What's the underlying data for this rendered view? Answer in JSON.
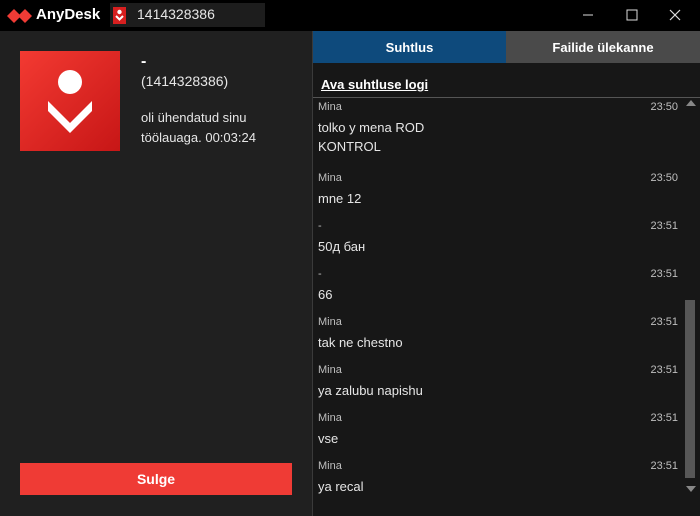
{
  "titlebar": {
    "app_name": "AnyDesk",
    "address": "1414328386",
    "icons": {
      "logo": "anydesk-logo-icon",
      "address": "anydesk-id-icon",
      "minimize": "minimize-icon",
      "maximize": "maximize-icon",
      "close": "close-icon"
    }
  },
  "session": {
    "peer_name": "-",
    "peer_id": "(1414328386)",
    "status": "oli ühendatud sinu töölauaga. 00:03:24",
    "close_label": "Sulge"
  },
  "tabs": [
    {
      "label": "Suhtlus",
      "active": true
    },
    {
      "label": "Failide ülekanne",
      "active": false
    }
  ],
  "chat": {
    "log_link": "Ava suhtluse logi",
    "messages": [
      {
        "sender": "Mina",
        "time": "23:50",
        "text": "tolko y mena ROD\nKONTROL"
      },
      {
        "sender": "Mina",
        "time": "23:50",
        "text": "mne 12"
      },
      {
        "sender": "-",
        "time": "23:51",
        "text": "50д бан"
      },
      {
        "sender": "-",
        "time": "23:51",
        "text": "66"
      },
      {
        "sender": "Mina",
        "time": "23:51",
        "text": "tak ne chestno"
      },
      {
        "sender": "Mina",
        "time": "23:51",
        "text": "ya zalubu napishu"
      },
      {
        "sender": "Mina",
        "time": "23:51",
        "text": "vse"
      },
      {
        "sender": "Mina",
        "time": "23:51",
        "text": "ya recal"
      }
    ]
  },
  "colors": {
    "accent_red": "#ef3b35",
    "tab_active": "#0e4a7c",
    "tab_inactive": "#4a4a4a"
  }
}
